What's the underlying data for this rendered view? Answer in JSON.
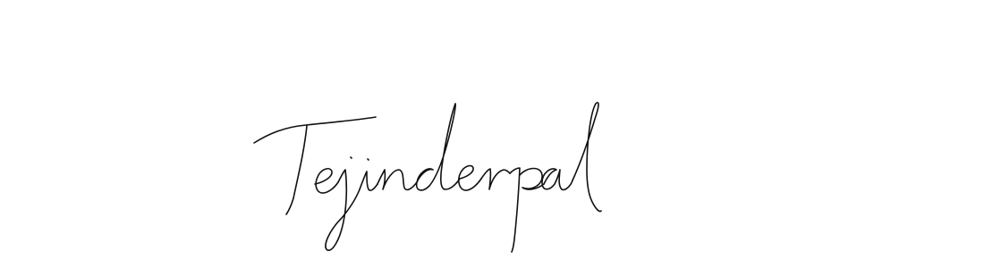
{
  "signature": {
    "text": "Tejinderpal",
    "ink_color": "#111111",
    "background_color": "#ffffff"
  }
}
